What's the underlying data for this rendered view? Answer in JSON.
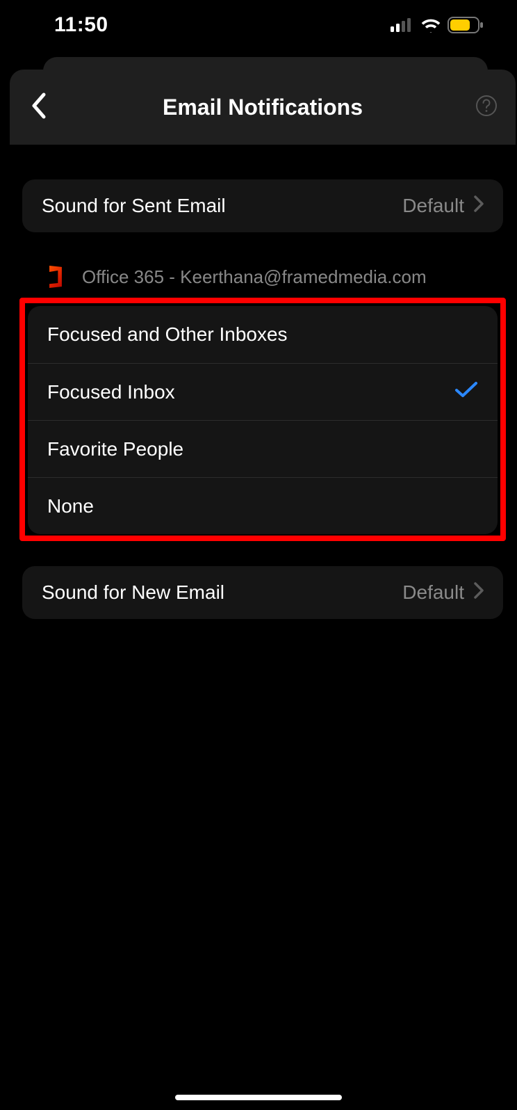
{
  "status_bar": {
    "time": "11:50"
  },
  "nav": {
    "title": "Email Notifications"
  },
  "sent_sound": {
    "label": "Sound for Sent Email",
    "value": "Default"
  },
  "account": {
    "label": "Office 365 - Keerthana@framedmedia.com"
  },
  "options": [
    {
      "label": "Focused and Other Inboxes",
      "selected": false
    },
    {
      "label": "Focused Inbox",
      "selected": true
    },
    {
      "label": "Favorite People",
      "selected": false
    },
    {
      "label": "None",
      "selected": false
    }
  ],
  "new_sound": {
    "label": "Sound for New Email",
    "value": "Default"
  }
}
